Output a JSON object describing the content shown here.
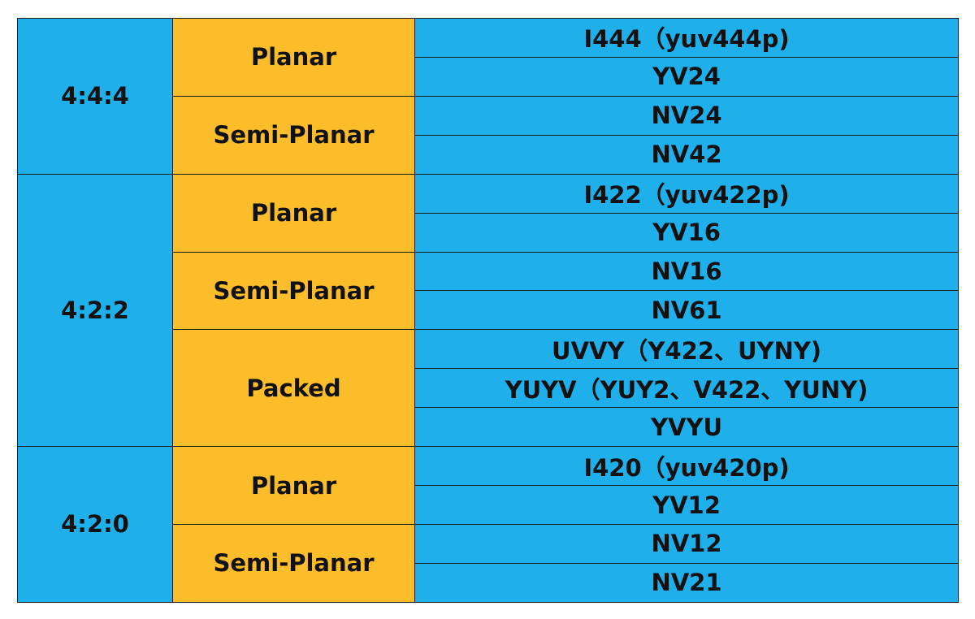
{
  "colors": {
    "blue": "#1fb0ec",
    "orange": "#fcbd2b",
    "border": "#1a1a1a",
    "text": "#111111"
  },
  "groups": [
    {
      "sampling": "4:4:4",
      "layouts": [
        {
          "name": "Planar",
          "formats": [
            "I444（yuv444p)",
            "YV24"
          ]
        },
        {
          "name": "Semi-Planar",
          "formats": [
            "NV24",
            "NV42"
          ]
        }
      ]
    },
    {
      "sampling": "4:2:2",
      "layouts": [
        {
          "name": "Planar",
          "formats": [
            "I422（yuv422p)",
            "YV16"
          ]
        },
        {
          "name": "Semi-Planar",
          "formats": [
            "NV16",
            "NV61"
          ]
        },
        {
          "name": "Packed",
          "formats": [
            "UVVY（Y422、UYNY)",
            "YUYV（YUY2、V422、YUNY)",
            "YVYU"
          ]
        }
      ]
    },
    {
      "sampling": "4:2:0",
      "layouts": [
        {
          "name": "Planar",
          "formats": [
            "I420（yuv420p)",
            "YV12"
          ]
        },
        {
          "name": "Semi-Planar",
          "formats": [
            "NV12",
            "NV21"
          ]
        }
      ]
    }
  ]
}
